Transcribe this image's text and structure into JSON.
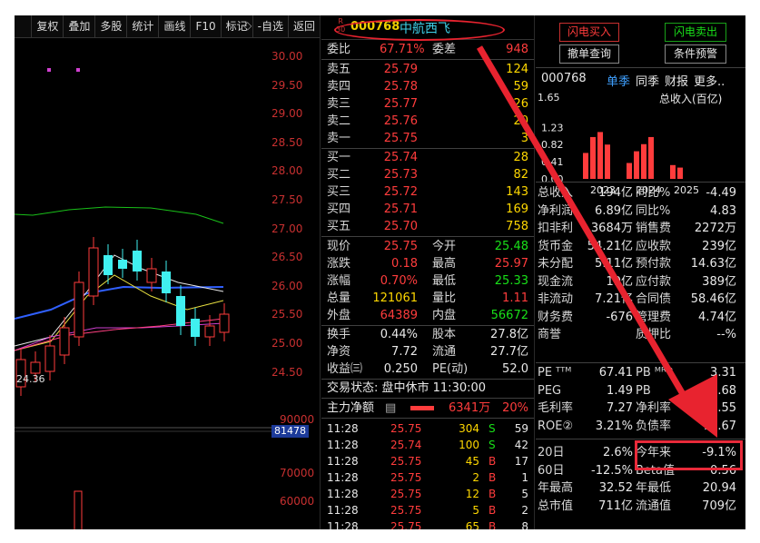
{
  "toolbar": {
    "items": [
      "复权",
      "叠加",
      "多股",
      "统计",
      "画线",
      "F10",
      "标记",
      "-自选",
      "返回"
    ],
    "diamond": "◇"
  },
  "price_axis": [
    "30.00",
    "29.50",
    "29.00",
    "28.50",
    "28.00",
    "27.50",
    "27.00",
    "26.50",
    "26.00",
    "25.50",
    "25.00",
    "24.50"
  ],
  "low_label": "24.36",
  "volume_axis": [
    "90000",
    "70000",
    "60000"
  ],
  "volume_current": "81478",
  "stock": {
    "code": "000768",
    "name": "中航西飞",
    "super_top": "R",
    "super_bottom": "30"
  },
  "weibi": {
    "label": "委比",
    "value": "67.71%",
    "label2": "委差",
    "value2": "948"
  },
  "asks": [
    {
      "label": "卖五",
      "price": "25.79",
      "vol": "124"
    },
    {
      "label": "卖四",
      "price": "25.78",
      "vol": "59"
    },
    {
      "label": "卖三",
      "price": "25.77",
      "vol": "26"
    },
    {
      "label": "卖二",
      "price": "25.76",
      "vol": "20"
    },
    {
      "label": "卖一",
      "price": "25.75",
      "vol": "3"
    }
  ],
  "bids": [
    {
      "label": "买一",
      "price": "25.74",
      "vol": "28"
    },
    {
      "label": "买二",
      "price": "25.73",
      "vol": "82"
    },
    {
      "label": "买三",
      "price": "25.72",
      "vol": "143"
    },
    {
      "label": "买四",
      "price": "25.71",
      "vol": "169"
    },
    {
      "label": "买五",
      "price": "25.70",
      "vol": "758"
    }
  ],
  "quote": [
    {
      "l1": "现价",
      "v1": "25.75",
      "c1": "red",
      "l2": "今开",
      "v2": "25.48",
      "c2": "green"
    },
    {
      "l1": "涨跌",
      "v1": "0.18",
      "c1": "red",
      "l2": "最高",
      "v2": "25.97",
      "c2": "red"
    },
    {
      "l1": "涨幅",
      "v1": "0.70%",
      "c1": "red",
      "l2": "最低",
      "v2": "25.33",
      "c2": "green"
    },
    {
      "l1": "总量",
      "v1": "121061",
      "c1": "yellow",
      "l2": "量比",
      "v2": "1.11",
      "c2": "red"
    },
    {
      "l1": "外盘",
      "v1": "64389",
      "c1": "red",
      "l2": "内盘",
      "v2": "56672",
      "c2": "green"
    }
  ],
  "quote2": [
    {
      "l1": "换手",
      "v1": "0.44%",
      "l2": "股本",
      "v2": "27.8亿"
    },
    {
      "l1": "净资",
      "v1": "7.72",
      "l2": "流通",
      "v2": "27.7亿"
    },
    {
      "l1": "收益㈢",
      "v1": "0.250",
      "l2": "PE(动)",
      "v2": "52.0"
    }
  ],
  "trade_status": "交易状态: 盘中休市 11:30:00",
  "main_flow": {
    "label": "主力净额",
    "icon": "▤",
    "value": "6341万",
    "pct": "20%"
  },
  "ticks": [
    {
      "t": "11:28",
      "p": "25.75",
      "v": "304",
      "s": "S",
      "n": "59"
    },
    {
      "t": "11:28",
      "p": "25.74",
      "v": "100",
      "s": "S",
      "n": "42"
    },
    {
      "t": "11:28",
      "p": "25.75",
      "v": "45",
      "s": "B",
      "n": "17"
    },
    {
      "t": "11:28",
      "p": "25.75",
      "v": "2",
      "s": "B",
      "n": "1"
    },
    {
      "t": "11:28",
      "p": "25.75",
      "v": "12",
      "s": "B",
      "n": "5"
    },
    {
      "t": "11:28",
      "p": "25.75",
      "v": "5",
      "s": "B",
      "n": "2"
    },
    {
      "t": "11:28",
      "p": "25.75",
      "v": "65",
      "s": "B",
      "n": "8"
    }
  ],
  "buttons": {
    "flash_buy": "闪电买入",
    "flash_sell": "闪电卖出",
    "cancel_query": "撤单查询",
    "condition_alert": "条件预警"
  },
  "fin": {
    "code": "000768",
    "tabs": [
      "单季",
      "同季",
      "财报",
      "更多.."
    ],
    "ymax": "1.65",
    "yticks": [
      "1.65",
      "1.23",
      "0.82",
      "0.41",
      "0.00"
    ],
    "chart_title": "总收入(百亿)",
    "years": [
      "2023",
      "2024",
      "2025"
    ]
  },
  "chart_data": {
    "type": "bar",
    "title": "总收入(百亿)",
    "categories": [
      "2023",
      "2023",
      "2023",
      "2023",
      "2024",
      "2024",
      "2024",
      "2024",
      "2025",
      "2025"
    ],
    "values": [
      0.62,
      1.0,
      1.12,
      0.82,
      0.38,
      0.66,
      0.83,
      1.0,
      0.33,
      0.27
    ],
    "ylim": [
      0,
      1.65
    ]
  },
  "fin_rows": [
    {
      "l1": "总收入",
      "v1": "194亿",
      "l2": "同比%",
      "v2": "-4.49",
      "c2": "white"
    },
    {
      "l1": "净利润",
      "v1": "6.89亿",
      "l2": "同比%",
      "v2": "4.83",
      "c2": "white"
    },
    {
      "l1": "扣非利",
      "v1": "3684万",
      "l2": "销售费",
      "v2": "2272万",
      "c2": "white"
    },
    {
      "l1": "货币金",
      "v1": "54.21亿",
      "l2": "应收款",
      "v2": "239亿",
      "c2": "white"
    },
    {
      "l1": "未分配",
      "v1": "5.11亿",
      "l2": "预付款",
      "v2": "14.63亿",
      "c2": "white"
    },
    {
      "l1": "现金流",
      "v1": "19亿",
      "l2": "应付款",
      "v2": "389亿",
      "c2": "white"
    },
    {
      "l1": "非流动",
      "v1": "7.21亿",
      "l2": "合同债",
      "v2": "58.46亿",
      "c2": "white"
    },
    {
      "l1": "财务费",
      "v1": "-676",
      "l2": "管理费",
      "v2": "4.74亿",
      "c2": "white"
    },
    {
      "l1": "商誉",
      "v1": "",
      "l2": "质押比",
      "v2": "--%",
      "c2": "white"
    }
  ],
  "val_rows": [
    {
      "l1": "PE ᵀᵀᴹ",
      "v1": "67.41",
      "l2": "PB ᴹᴿᑫ",
      "v2": "3.31"
    },
    {
      "l1": "PEG",
      "v1": "1.49",
      "l2": "PB",
      "v2": "1.68"
    },
    {
      "l1": "毛利率",
      "v1": "7.27",
      "l2": "净利率",
      "v2": "3.55"
    },
    {
      "l1": "ROE②",
      "v1": "3.21%",
      "l2": "负债率",
      "v2": "70.67"
    }
  ],
  "perf_rows": [
    {
      "l1": "20日",
      "v1": "2.6%",
      "l2": "今年来",
      "v2": "-9.1%"
    },
    {
      "l1": "60日",
      "v1": "-12.5%",
      "l2": "Beta值",
      "v2": "0.56"
    },
    {
      "l1": "年最高",
      "v1": "32.52",
      "l2": "年最低",
      "v2": "20.94"
    },
    {
      "l1": "总市值",
      "v1": "711亿",
      "l2": "流通值",
      "v2": "709亿"
    }
  ],
  "colors": {
    "up": "#ff3c3c",
    "down": "#19e019",
    "highlight": "#e82a3a"
  }
}
